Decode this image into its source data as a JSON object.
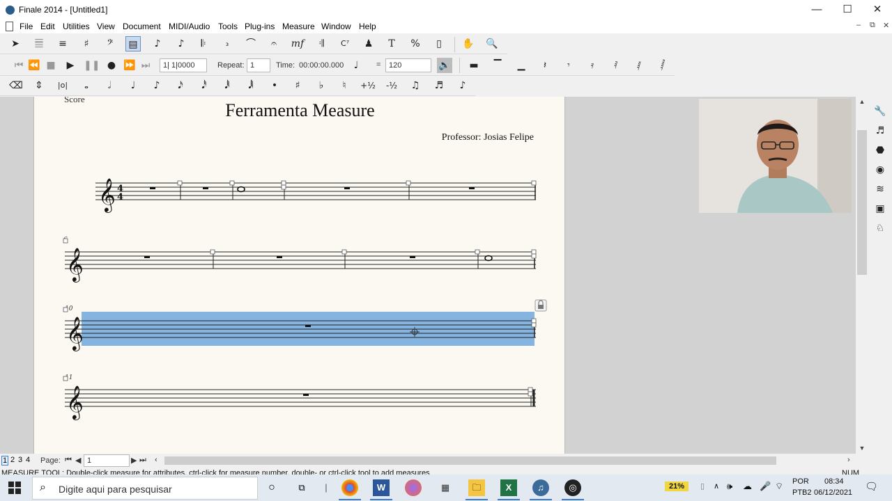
{
  "window": {
    "title": "Finale 2014 - [Untitled1]",
    "minimize": "—",
    "maximize": "☐",
    "close": "✕"
  },
  "menu": {
    "items": [
      "File",
      "Edit",
      "Utilities",
      "View",
      "Document",
      "MIDI/Audio",
      "Tools",
      "Plug-ins",
      "Measure",
      "Window",
      "Help"
    ],
    "mdi_minimize": "–",
    "mdi_restore": "⧉",
    "mdi_close": "✕"
  },
  "playback": {
    "position": "1| 1|0000",
    "repeat_label": "Repeat:",
    "repeat_value": "1",
    "time_label": "Time:",
    "time_value": "00:00:00.000",
    "tempo_equals": "=",
    "tempo_value": "120"
  },
  "score": {
    "label": "Score",
    "title": "Ferramenta Measure",
    "composer": "Professor: Josias Felipe",
    "measure_numbers": [
      "6",
      "10",
      "11"
    ]
  },
  "bottom": {
    "layers": [
      "1",
      "2",
      "3",
      "4"
    ],
    "page_label": "Page:",
    "page_value": "1"
  },
  "status": {
    "text": "MEASURE TOOL: Double-click measure for attributes, ctrl-click for measure number, double- or ctrl-click tool to add measures",
    "num": "NUM"
  },
  "taskbar": {
    "search_placeholder": "Digite aqui para pesquisar",
    "battery": "21%",
    "lang1": "POR",
    "lang2": "PTB2",
    "time": "08:34",
    "date": "06/12/2021"
  },
  "colors": {
    "selection": "#6fa8dc",
    "page": "#fbf9f2",
    "workspace": "#d2d2d2"
  }
}
